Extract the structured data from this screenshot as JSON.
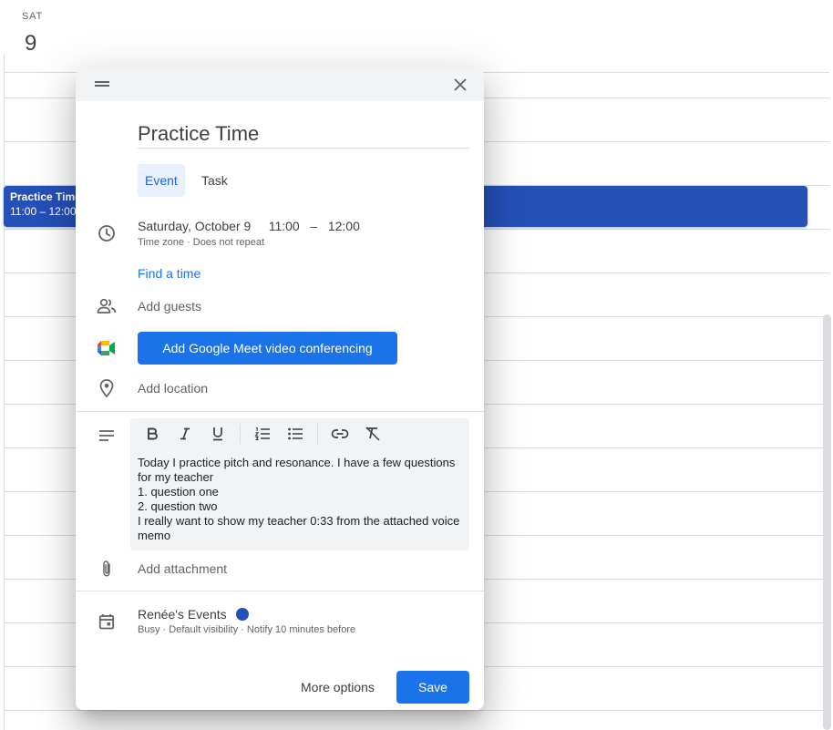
{
  "calendar": {
    "day_name": "SAT",
    "day_number": "9",
    "event": {
      "title": "Practice Time",
      "time": "11:00 – 12:00",
      "color": "#2550b8"
    }
  },
  "dialog": {
    "title_value": "Practice Time",
    "tabs": [
      {
        "label": "Event",
        "active": true
      },
      {
        "label": "Task",
        "active": false
      }
    ],
    "schedule": {
      "date": "Saturday, October 9",
      "start_time": "11:00",
      "separator": "–",
      "end_time": "12:00",
      "time_zone_label": "Time zone",
      "recurrence_label": "Does not repeat",
      "find_time_label": "Find a time"
    },
    "guests_placeholder": "Add guests",
    "meet_button_label": "Add Google Meet video conferencing",
    "location_placeholder": "Add location",
    "description": {
      "toolbar": [
        "bold-icon",
        "italic-icon",
        "underline-icon",
        "numbered-list-icon",
        "bulleted-list-icon",
        "link-icon",
        "clear-formatting-icon"
      ],
      "lines": [
        "Today I practice pitch and resonance. I have a few questions for my teacher",
        "1. question one",
        "2. question two",
        "I really want to show my teacher 0:33 from the attached voice memo"
      ]
    },
    "attachment_label": "Add attachment",
    "calendar_owner": {
      "name": "Renée's Events",
      "dot_color": "#2550b8",
      "busy": "Busy",
      "visibility": "Default visibility",
      "notify": "Notify 10 minutes before"
    },
    "more_options_label": "More options",
    "save_label": "Save",
    "accent_color": "#1a73e8"
  }
}
